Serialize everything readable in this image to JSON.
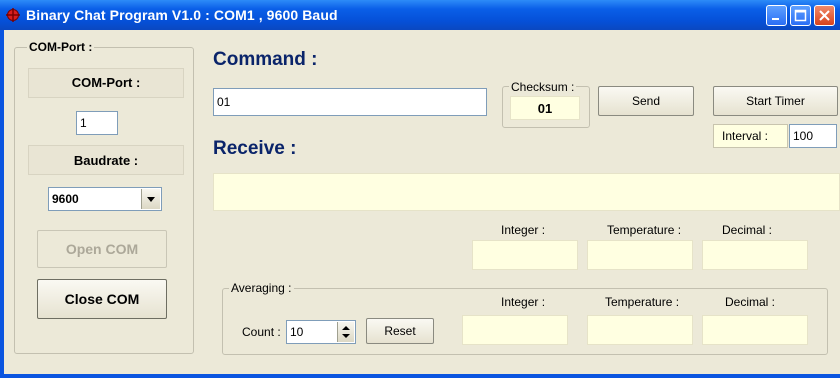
{
  "window": {
    "title": "Binary Chat Program V1.0 : COM1 , 9600 Baud"
  },
  "left_panel": {
    "group_label": "COM-Port :",
    "com_port_button": "COM-Port :",
    "com_port_value": "1",
    "baudrate_button": "Baudrate :",
    "baudrate_value": "9600",
    "open_com": "Open COM",
    "close_com": "Close COM"
  },
  "command": {
    "header": "Command :",
    "value": "01",
    "checksum_label": "Checksum :",
    "checksum_value": "01",
    "send": "Send",
    "start_timer": "Start Timer",
    "interval_label": "Interval :",
    "interval_value": "100"
  },
  "receive": {
    "header": "Receive :",
    "value": "",
    "integer_label": "Integer :",
    "temperature_label": "Temperature :",
    "decimal_label": "Decimal :"
  },
  "averaging": {
    "group_label": "Averaging :",
    "count_label": "Count :",
    "count_value": "10",
    "reset": "Reset",
    "integer_label": "Integer :",
    "temperature_label": "Temperature :",
    "decimal_label": "Decimal :"
  },
  "colors": {
    "title_blue": "#0a55e0",
    "face": "#ece9d8",
    "readout_yellow": "#ffffe1",
    "header_navy": "#0a246a"
  }
}
